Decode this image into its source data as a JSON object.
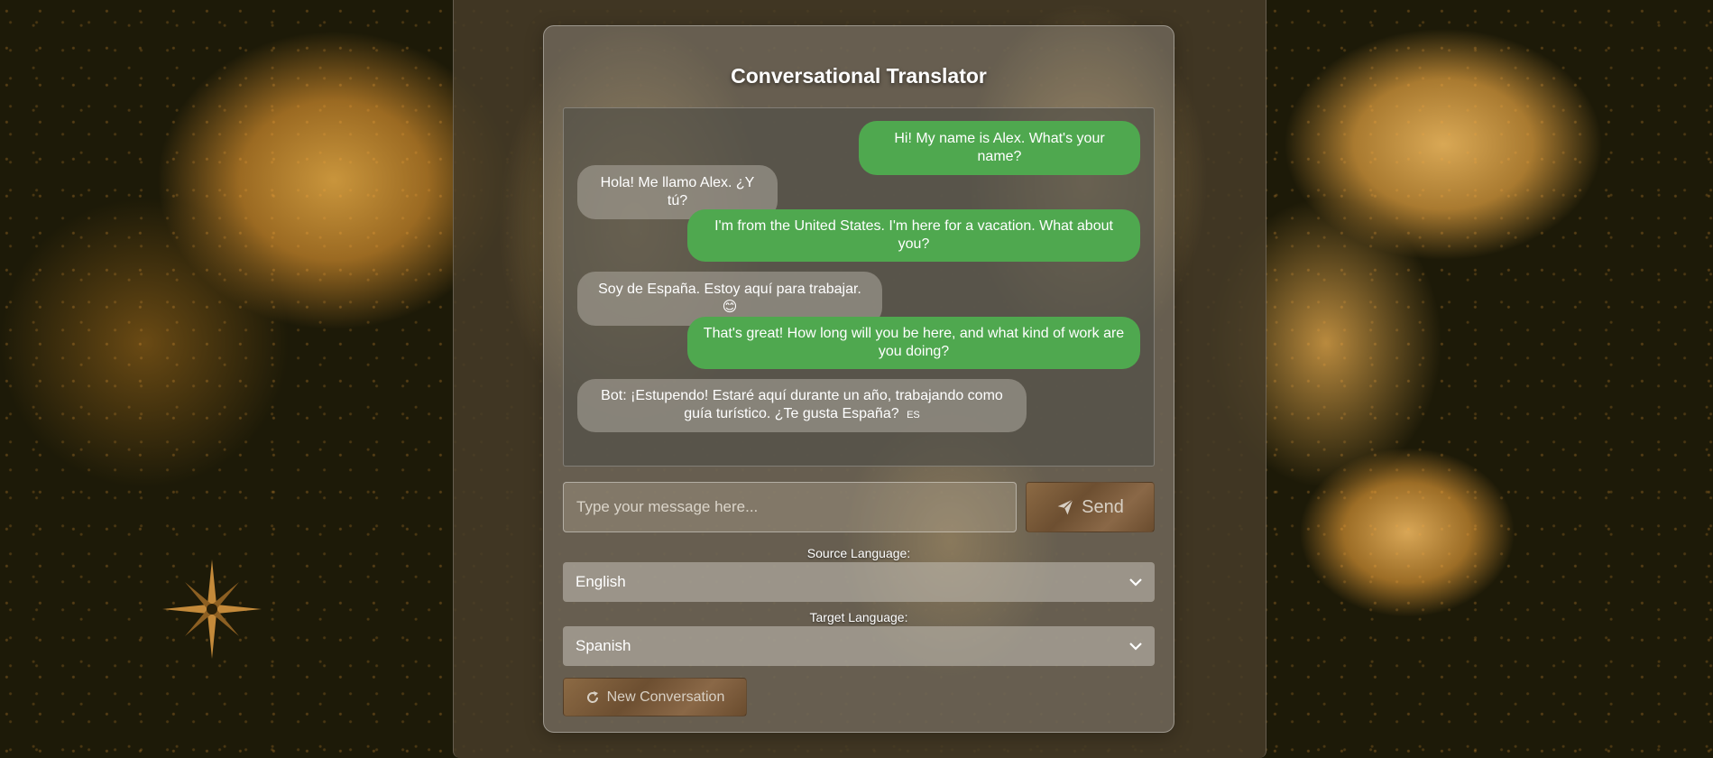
{
  "app": {
    "title": "Conversational Translator"
  },
  "messages": [
    {
      "role": "user",
      "text": "Hi! My name is Alex. What's your name?"
    },
    {
      "role": "bot",
      "text": "Hola! Me llamo Alex. ¿Y tú?"
    },
    {
      "role": "user",
      "text": "I'm from the United States. I'm here for a vacation. What about you?"
    },
    {
      "role": "bot",
      "text": "Soy de España. Estoy aquí para trabajar. 😊"
    },
    {
      "role": "user",
      "text": "That's great! How long will you be here, and what kind of work are you doing?"
    },
    {
      "role": "bot",
      "text": "Bot: ¡Estupendo! Estaré aquí durante un año, trabajando como guía turístico. ¿Te gusta España?",
      "lang_tag": "ES"
    }
  ],
  "input": {
    "placeholder": "Type your message here...",
    "value": ""
  },
  "send_button": {
    "label": "Send",
    "icon": "paper-plane-icon"
  },
  "source_language": {
    "label": "Source Language:",
    "value": "English"
  },
  "target_language": {
    "label": "Target Language:",
    "value": "Spanish"
  },
  "new_conversation_button": {
    "label": "New Conversation",
    "icon": "refresh-icon"
  },
  "colors": {
    "user_bubble": "#4fa84f",
    "button_brown": "#7a5a3a"
  }
}
